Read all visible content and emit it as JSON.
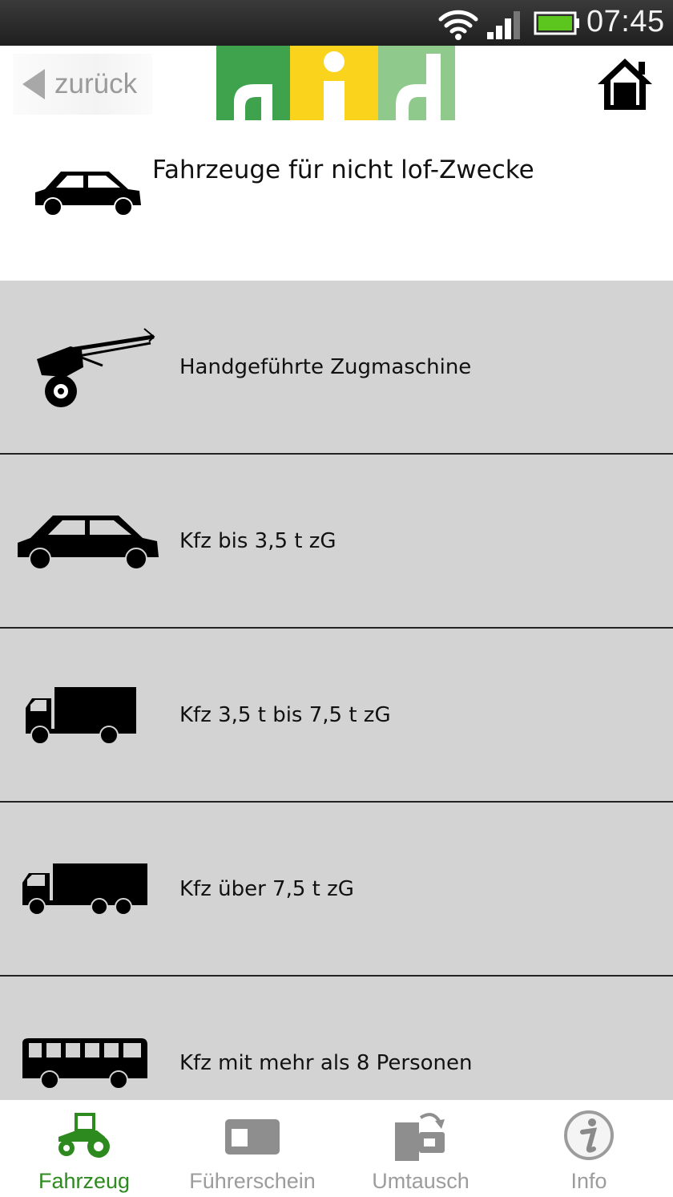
{
  "status_bar": {
    "time": "07:45"
  },
  "header": {
    "back_label": "zurück",
    "logo_letters": [
      "a",
      "i",
      "d"
    ],
    "colors": {
      "logo_green": "#3fa34d",
      "logo_yellow": "#f9d31c",
      "logo_light_green": "#8fc98c"
    }
  },
  "title": {
    "text": "Fahrzeuge für nicht lof-Zwecke",
    "icon": "car-icon"
  },
  "list": {
    "items": [
      {
        "label": "Handgeführte Zugmaschine",
        "icon": "walking-tractor-icon"
      },
      {
        "label": "Kfz bis 3,5 t zG",
        "icon": "car-icon"
      },
      {
        "label": "Kfz 3,5 t bis 7,5 t zG",
        "icon": "truck-icon"
      },
      {
        "label": "Kfz über 7,5 t zG",
        "icon": "large-truck-icon"
      },
      {
        "label": "Kfz mit mehr als 8 Personen",
        "icon": "bus-icon"
      }
    ]
  },
  "tabs": [
    {
      "label": "Fahrzeug",
      "icon": "tractor-icon",
      "active": true
    },
    {
      "label": "Führerschein",
      "icon": "license-card-icon",
      "active": false
    },
    {
      "label": "Umtausch",
      "icon": "exchange-icon",
      "active": false
    },
    {
      "label": "Info",
      "icon": "info-icon",
      "active": false
    }
  ],
  "colors": {
    "accent": "#2d8a1e",
    "list_bg": "#d3d3d3",
    "inactive_tab": "#9c9c9c"
  }
}
